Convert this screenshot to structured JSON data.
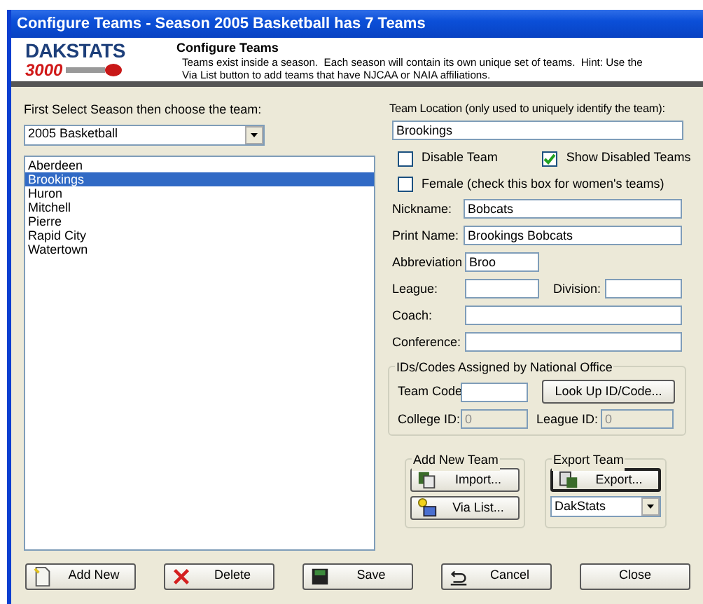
{
  "window": {
    "title": "Configure Teams - Season 2005 Basketball has 7 Teams"
  },
  "header": {
    "logo_word": "DAKSTATS",
    "logo_number": "3000",
    "title": "Configure Teams",
    "lines": [
      "Teams exist inside a season.  Each season will contain its own unique set of teams.  Hint: Use the",
      "Via List button to add teams that have NJCAA or NAIA affiliations."
    ]
  },
  "season": {
    "label": "First Select Season then choose the team:",
    "value": "2005 Basketball"
  },
  "teams": [
    {
      "name": "Aberdeen",
      "selected": false
    },
    {
      "name": "Brookings",
      "selected": true
    },
    {
      "name": "Huron",
      "selected": false
    },
    {
      "name": "Mitchell",
      "selected": false
    },
    {
      "name": "Pierre",
      "selected": false
    },
    {
      "name": "Rapid City",
      "selected": false
    },
    {
      "name": "Watertown",
      "selected": false
    }
  ],
  "location": {
    "label": "Team Location (only used to uniquely identify the team):",
    "value": "Brookings"
  },
  "checkboxes": [
    {
      "label": "Disable Team",
      "checked": false
    },
    {
      "label": "Show Disabled Teams",
      "checked": true
    },
    {
      "label": "Female (check this box for women's teams)",
      "checked": false
    }
  ],
  "nickname": {
    "label": "Nickname:",
    "value": "Bobcats"
  },
  "print_name": {
    "label": "Print Name:",
    "value": "Brookings Bobcats"
  },
  "abbreviation": {
    "label": "Abbreviation",
    "value": "Broo"
  },
  "league": {
    "label": "League:"
  },
  "division": {
    "label": "Division:"
  },
  "coach": {
    "label": "Coach:"
  },
  "conference": {
    "label": "Conference:"
  },
  "ids": {
    "title": "IDs/Codes Assigned by National Office",
    "team_code": {
      "label": "Team Code"
    },
    "lookup_button": "Look Up ID/Code...",
    "college_id": {
      "label": "College ID:",
      "value": "0",
      "disabled": true
    },
    "league_id": {
      "label": "League ID:",
      "value": "0",
      "disabled": true
    }
  },
  "add_new_team": {
    "title": "Add New Team",
    "buttons": [
      {
        "kind": "import",
        "label": "Import..."
      },
      {
        "kind": "list",
        "label": "Via List..."
      }
    ]
  },
  "export_team": {
    "title": "Export Team",
    "button": "Export...",
    "format": "DakStats"
  },
  "buttons": [
    {
      "kind": "add",
      "label": "Add New"
    },
    {
      "kind": "delete",
      "label": "Delete"
    },
    {
      "kind": "save",
      "label": "Save"
    },
    {
      "kind": "cancel",
      "label": "Cancel"
    },
    {
      "kind": "close",
      "label": "Close"
    }
  ]
}
